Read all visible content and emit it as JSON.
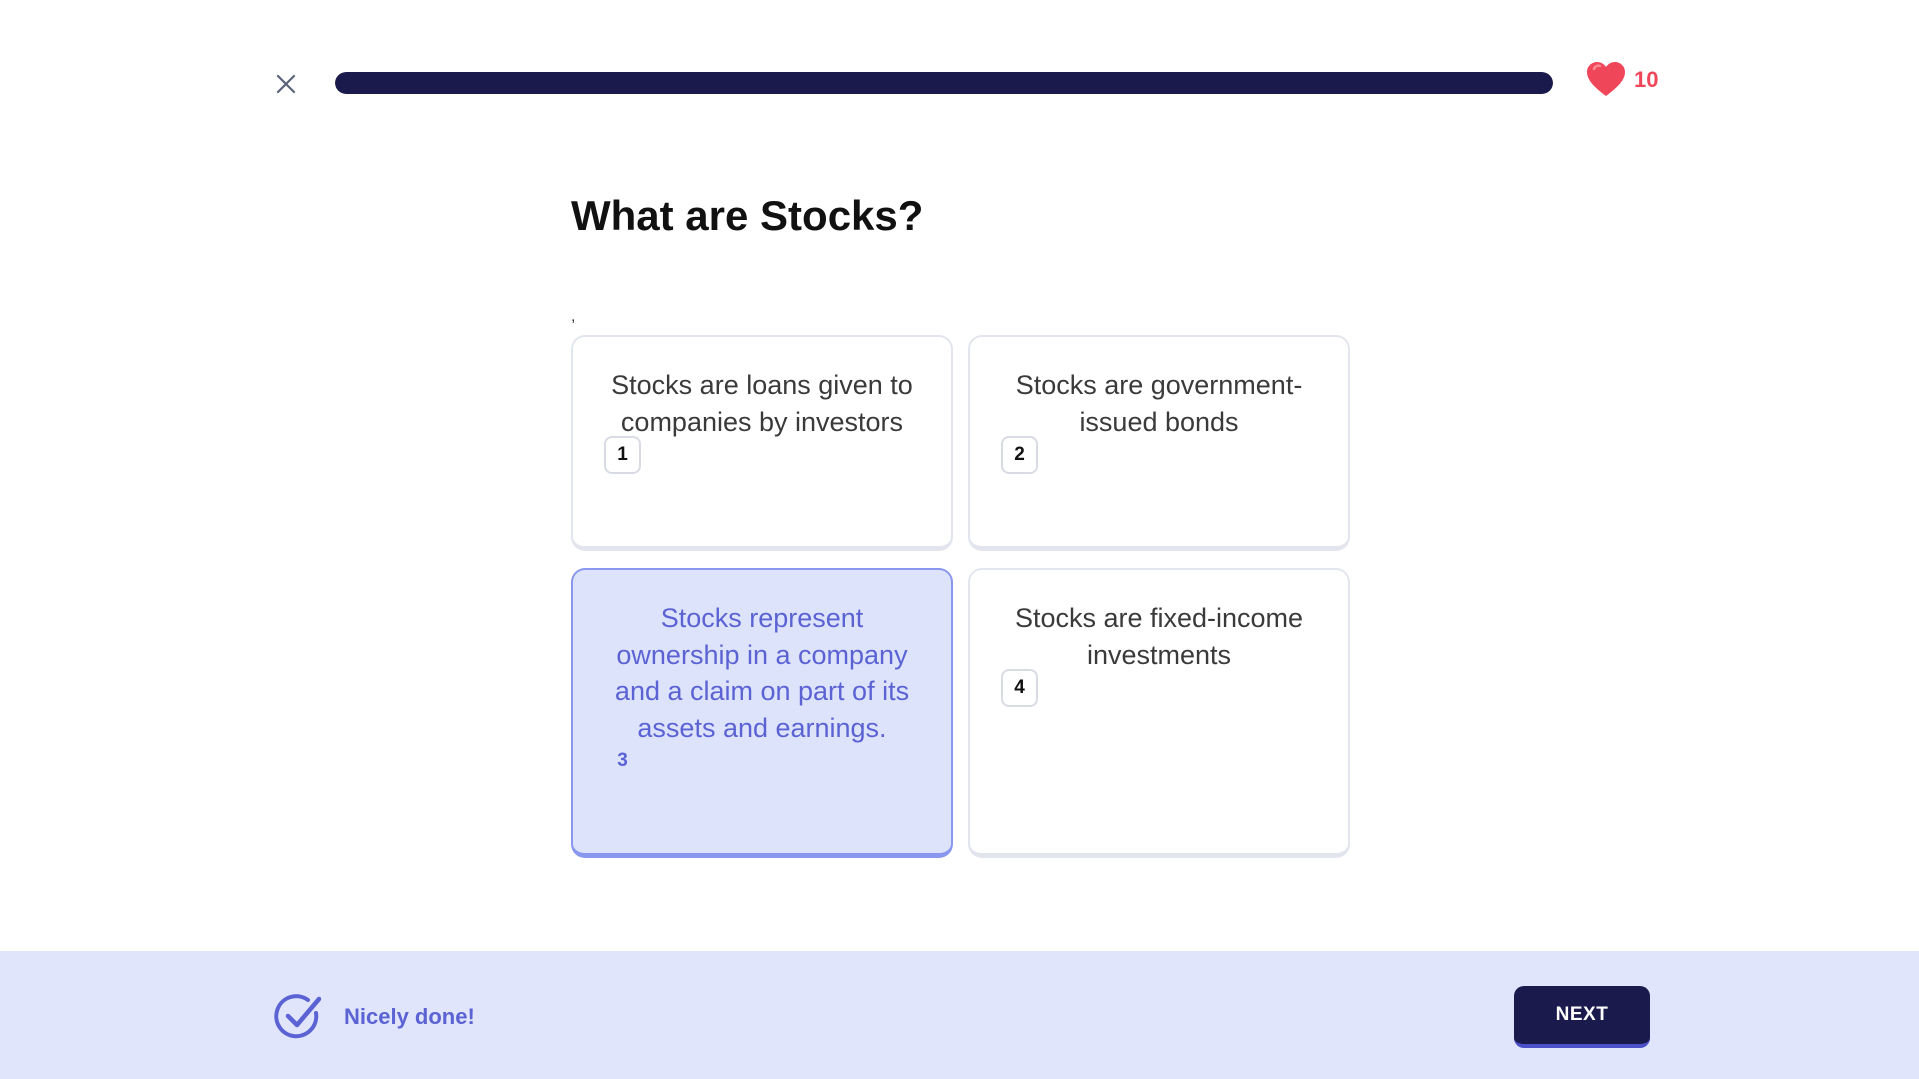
{
  "header": {
    "progress_fraction": 1.0,
    "lives": "10"
  },
  "question": {
    "title": "What are Stocks?",
    "stray_text": ","
  },
  "options": [
    {
      "key": "1",
      "text": "Stocks are loans given to companies by investors",
      "selected": false
    },
    {
      "key": "2",
      "text": "Stocks are government-issued bonds",
      "selected": false
    },
    {
      "key": "3",
      "text": "Stocks represent ownership in a company and a claim on part of its assets and earnings.",
      "selected": true
    },
    {
      "key": "4",
      "text": "Stocks are fixed-income investments",
      "selected": false
    }
  ],
  "footer": {
    "feedback": "Nicely done!",
    "next_label": "NEXT"
  },
  "colors": {
    "navy": "#1b1a4d",
    "accent": "#5b63d4",
    "selected_bg": "#dde3fb",
    "footer_bg": "#e0e5fb",
    "heart": "#f0465a"
  },
  "icons": {
    "close": "close-icon",
    "lives": "heart-icon",
    "feedback": "check-circle-icon"
  }
}
